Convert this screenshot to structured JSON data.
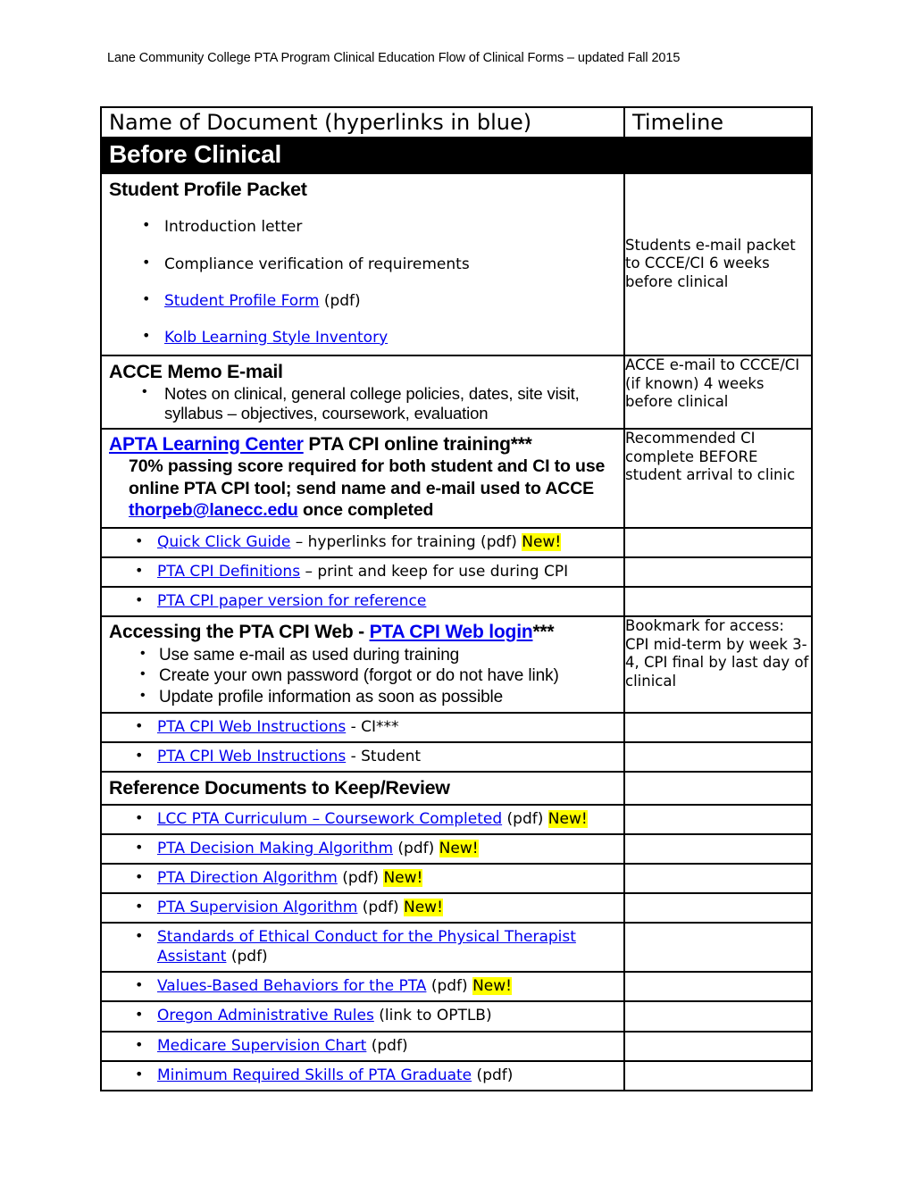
{
  "document": {
    "running_header": "Lane Community College PTA Program Clinical Education Flow of Clinical Forms – updated Fall 2015"
  },
  "colors": {
    "hyperlink": "#0000EE",
    "highlight": "#FFFF00",
    "banner_background": "#000000",
    "banner_text": "#FFFFFF"
  },
  "table": {
    "headers": {
      "name_of_document": "Name of Document (hyperlinks in blue)",
      "timeline": "Timeline"
    },
    "section_banner": "Before Clinical",
    "rows": {
      "student_profile": {
        "title": "Student Profile Packet",
        "bullets": {
          "b1": "Introduction letter",
          "b2": "Compliance verification of requirements",
          "b3_link": "Student Profile Form",
          "b3_suffix": " (pdf)",
          "b4_link": "Kolb Learning Style Inventory"
        },
        "timeline": "Students e-mail packet to CCCE/CI  6 weeks before clinical"
      },
      "acce_memo": {
        "title": "ACCE Memo E-mail",
        "bullet": "Notes on clinical, general college policies, dates, site visit, syllabus – objectives, coursework, evaluation",
        "timeline": "ACCE e-mail to CCCE/CI (if known) 4 weeks before clinical"
      },
      "apta_training": {
        "heading_link": "APTA Learning Center",
        "heading_rest": " PTA CPI online training***",
        "body_part1": "70% passing score required for both student and CI to use online PTA CPI tool; send name and e-mail used to ACCE ",
        "body_email": "thorpeb@lanecc.edu",
        "body_part2": " once completed",
        "timeline": "Recommended CI complete BEFORE student arrival to clinic"
      },
      "quick_click": {
        "link": "Quick Click Guide",
        "rest": " – hyperlinks for training (pdf) ",
        "badge": "New!"
      },
      "cpi_definitions": {
        "link": "PTA CPI Definitions",
        "rest": " – print and keep for use during CPI"
      },
      "cpi_paper": {
        "link": "PTA CPI paper version for reference"
      },
      "accessing_cpi_web": {
        "title_prefix": "Accessing the PTA CPI Web - ",
        "title_link": "PTA CPI Web login",
        "title_suffix": "***",
        "bullets": {
          "b1": "Use same e-mail as used during training",
          "b2": "Create your own password (forgot or do not have link)",
          "b3": "Update profile information as soon as possible"
        },
        "timeline": "Bookmark for access: CPI mid-term by week 3-4, CPI final by last day of clinical"
      },
      "cpi_instructions_ci": {
        "link": "PTA CPI Web Instructions",
        "rest": " - CI***"
      },
      "cpi_instructions_student": {
        "link": "PTA CPI Web Instructions",
        "rest": " - Student"
      },
      "reference_header": {
        "title": "Reference Documents to Keep/Review"
      },
      "ref_curriculum": {
        "link": "LCC PTA Curriculum – Coursework Completed",
        "rest": " (pdf) ",
        "badge": "New!"
      },
      "ref_decision": {
        "link": "PTA Decision Making Algorithm",
        "rest": " (pdf) ",
        "badge": "New!"
      },
      "ref_direction": {
        "link": "PTA Direction Algorithm",
        "rest": " (pdf) ",
        "badge": "New!"
      },
      "ref_supervision": {
        "link": "PTA Supervision Algorithm",
        "rest": " (pdf) ",
        "badge": "New!"
      },
      "ref_standards": {
        "link": "Standards of Ethical Conduct for the Physical Therapist Assistant",
        "rest": " (pdf)"
      },
      "ref_values": {
        "link": "Values-Based Behaviors for the PTA",
        "rest": " (pdf) ",
        "badge": "New!"
      },
      "ref_oregon": {
        "link": "Oregon Administrative Rules",
        "rest": " (link to OPTLB)"
      },
      "ref_medicare": {
        "link": "Medicare Supervision Chart",
        "rest": " (pdf)"
      },
      "ref_minimum": {
        "link": "Minimum Required Skills of PTA Graduate",
        "rest": " (pdf)"
      }
    }
  }
}
